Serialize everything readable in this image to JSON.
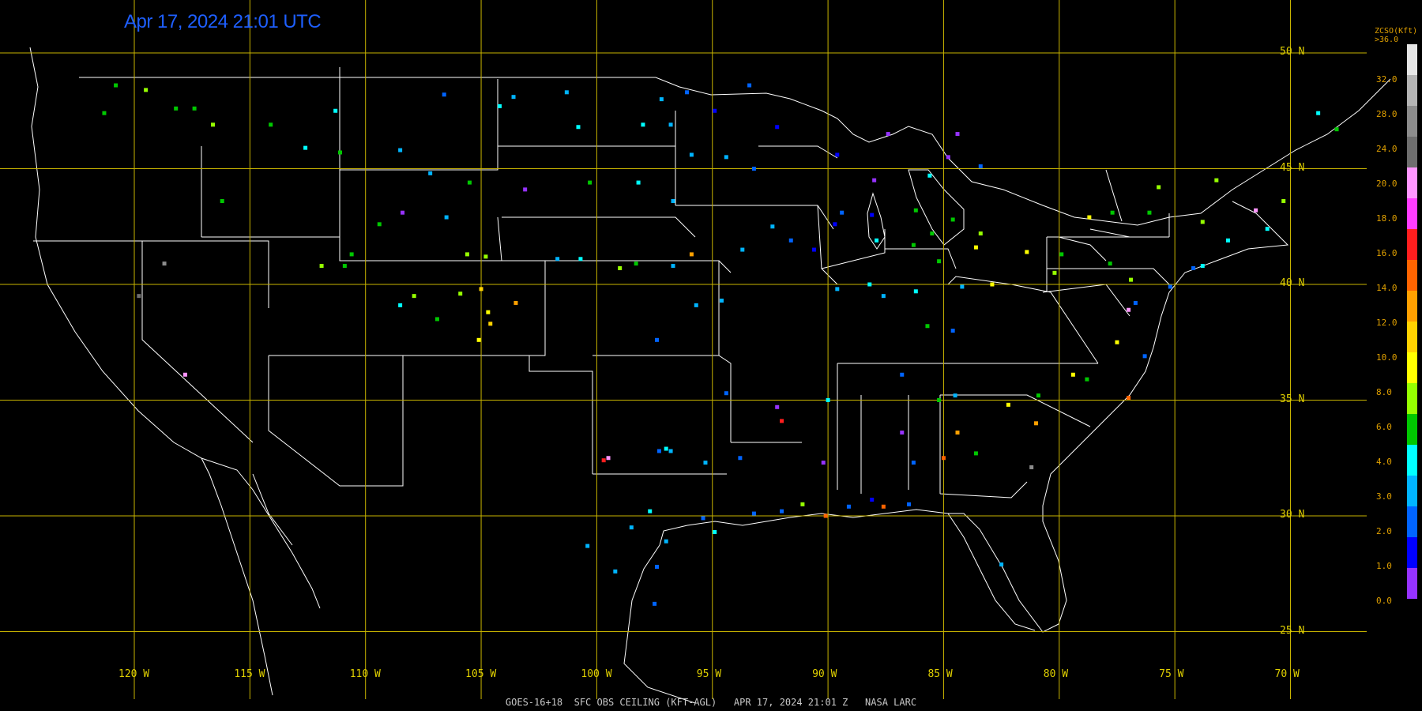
{
  "title": "Apr 17, 2024 21:01 UTC",
  "footer": "GOES-16+18  SFC OBS CEILING (KFT-AGL)   APR 17, 2024 21:01 Z   NASA LARC",
  "legend": {
    "title_line1": "ZCSO(Kft)",
    "title_line2": ">36.0",
    "labels": [
      "32.0",
      "28.0",
      "24.0",
      "20.0",
      "18.0",
      "16.0",
      "14.0",
      "12.0",
      "10.0",
      "8.0",
      "6.0",
      "4.0",
      "3.0",
      "2.0",
      "1.0",
      "0.0"
    ],
    "colors": [
      "#e6e6e6",
      "#b4b4b4",
      "#8c8c8c",
      "#6e6e6e",
      "#ff96ff",
      "#ff3cff",
      "#ff1e1e",
      "#ff6400",
      "#ffa000",
      "#ffd200",
      "#ffff00",
      "#96ff00",
      "#00c800",
      "#00ffff",
      "#00b4ff",
      "#0064ff",
      "#0000ff",
      "#9632ff"
    ]
  },
  "lat_labels": [
    "50 N",
    "45 N",
    "40 N",
    "35 N",
    "30 N",
    "25 N"
  ],
  "lon_labels": [
    "120 W",
    "115 W",
    "110 W",
    "105 W",
    "100 W",
    "95 W",
    "90 W",
    "85 W",
    "80 W",
    "75 W",
    "70 W"
  ],
  "stations": [
    {
      "lon": -120.8,
      "lat": 48.6,
      "c": "#00c800"
    },
    {
      "lon": -119.5,
      "lat": 48.4,
      "c": "#96ff00"
    },
    {
      "lon": -121.3,
      "lat": 47.4,
      "c": "#00c800"
    },
    {
      "lon": -118.2,
      "lat": 47.6,
      "c": "#00c800"
    },
    {
      "lon": -117.4,
      "lat": 47.6,
      "c": "#00c800"
    },
    {
      "lon": -116.6,
      "lat": 46.9,
      "c": "#96ff00"
    },
    {
      "lon": -116.2,
      "lat": 43.6,
      "c": "#00c800"
    },
    {
      "lon": -114.1,
      "lat": 46.9,
      "c": "#00c800"
    },
    {
      "lon": -112.6,
      "lat": 45.9,
      "c": "#00ffff"
    },
    {
      "lon": -111.1,
      "lat": 45.7,
      "c": "#00c800"
    },
    {
      "lon": -111.3,
      "lat": 47.5,
      "c": "#00ffff"
    },
    {
      "lon": -108.5,
      "lat": 45.8,
      "c": "#00b4ff"
    },
    {
      "lon": -106.6,
      "lat": 48.2,
      "c": "#0064ff"
    },
    {
      "lon": -104.2,
      "lat": 47.7,
      "c": "#00ffff"
    },
    {
      "lon": -103.6,
      "lat": 48.1,
      "c": "#00b4ff"
    },
    {
      "lon": -101.3,
      "lat": 48.3,
      "c": "#00b4ff"
    },
    {
      "lon": -100.8,
      "lat": 46.8,
      "c": "#00ffff"
    },
    {
      "lon": -98.0,
      "lat": 46.9,
      "c": "#00ffff"
    },
    {
      "lon": -96.8,
      "lat": 46.9,
      "c": "#00b4ff"
    },
    {
      "lon": -97.2,
      "lat": 48.0,
      "c": "#00b4ff"
    },
    {
      "lon": -96.1,
      "lat": 48.3,
      "c": "#0064ff"
    },
    {
      "lon": -94.9,
      "lat": 47.5,
      "c": "#0000ff"
    },
    {
      "lon": -93.4,
      "lat": 48.6,
      "c": "#0064ff"
    },
    {
      "lon": -92.2,
      "lat": 46.8,
      "c": "#0000ff"
    },
    {
      "lon": -93.2,
      "lat": 45.0,
      "c": "#0064ff"
    },
    {
      "lon": -94.4,
      "lat": 45.5,
      "c": "#00b4ff"
    },
    {
      "lon": -95.9,
      "lat": 45.6,
      "c": "#00b4ff"
    },
    {
      "lon": -96.7,
      "lat": 43.6,
      "c": "#00b4ff"
    },
    {
      "lon": -98.2,
      "lat": 44.4,
      "c": "#00ffff"
    },
    {
      "lon": -100.3,
      "lat": 44.4,
      "c": "#00c800"
    },
    {
      "lon": -103.1,
      "lat": 44.1,
      "c": "#9632ff"
    },
    {
      "lon": -104.8,
      "lat": 41.2,
      "c": "#96ff00"
    },
    {
      "lon": -105.6,
      "lat": 41.3,
      "c": "#96ff00"
    },
    {
      "lon": -106.5,
      "lat": 42.9,
      "c": "#00b4ff"
    },
    {
      "lon": -108.4,
      "lat": 43.1,
      "c": "#9632ff"
    },
    {
      "lon": -109.4,
      "lat": 42.6,
      "c": "#00c800"
    },
    {
      "lon": -107.2,
      "lat": 44.8,
      "c": "#00b4ff"
    },
    {
      "lon": -105.5,
      "lat": 44.4,
      "c": "#00c800"
    },
    {
      "lon": -105.0,
      "lat": 39.8,
      "c": "#ffd200"
    },
    {
      "lon": -104.7,
      "lat": 38.8,
      "c": "#ffff00"
    },
    {
      "lon": -104.6,
      "lat": 38.3,
      "c": "#ffd200"
    },
    {
      "lon": -103.5,
      "lat": 39.2,
      "c": "#ffa000"
    },
    {
      "lon": -105.9,
      "lat": 39.6,
      "c": "#96ff00"
    },
    {
      "lon": -107.9,
      "lat": 39.5,
      "c": "#96ff00"
    },
    {
      "lon": -108.5,
      "lat": 39.1,
      "c": "#00ffff"
    },
    {
      "lon": -106.9,
      "lat": 38.5,
      "c": "#00c800"
    },
    {
      "lon": -105.1,
      "lat": 37.6,
      "c": "#ffff00"
    },
    {
      "lon": -110.9,
      "lat": 40.8,
      "c": "#00c800"
    },
    {
      "lon": -111.9,
      "lat": 40.8,
      "c": "#96ff00"
    },
    {
      "lon": -110.6,
      "lat": 41.3,
      "c": "#00c800"
    },
    {
      "lon": -119.8,
      "lat": 39.5,
      "c": "#6e6e6e"
    },
    {
      "lon": -117.8,
      "lat": 36.1,
      "c": "#ff96ff"
    },
    {
      "lon": -118.7,
      "lat": 40.9,
      "c": "#8c8c8c"
    },
    {
      "lon": -101.7,
      "lat": 41.1,
      "c": "#00b4ff"
    },
    {
      "lon": -100.7,
      "lat": 41.1,
      "c": "#00ffff"
    },
    {
      "lon": -99.0,
      "lat": 40.7,
      "c": "#96ff00"
    },
    {
      "lon": -98.3,
      "lat": 40.9,
      "c": "#00c800"
    },
    {
      "lon": -96.7,
      "lat": 40.8,
      "c": "#00b4ff"
    },
    {
      "lon": -95.9,
      "lat": 41.3,
      "c": "#ffa000"
    },
    {
      "lon": -95.7,
      "lat": 39.1,
      "c": "#00b4ff"
    },
    {
      "lon": -97.4,
      "lat": 37.6,
      "c": "#0064ff"
    },
    {
      "lon": -94.6,
      "lat": 39.3,
      "c": "#00b4ff"
    },
    {
      "lon": -93.7,
      "lat": 41.5,
      "c": "#00b4ff"
    },
    {
      "lon": -92.4,
      "lat": 42.5,
      "c": "#00b4ff"
    },
    {
      "lon": -91.6,
      "lat": 41.9,
      "c": "#0064ff"
    },
    {
      "lon": -90.6,
      "lat": 41.5,
      "c": "#0000ff"
    },
    {
      "lon": -89.7,
      "lat": 42.6,
      "c": "#0000ff"
    },
    {
      "lon": -89.4,
      "lat": 43.1,
      "c": "#0064ff"
    },
    {
      "lon": -88.1,
      "lat": 43.0,
      "c": "#0000ff"
    },
    {
      "lon": -87.9,
      "lat": 41.9,
      "c": "#00ffff"
    },
    {
      "lon": -88.2,
      "lat": 40.0,
      "c": "#00ffff"
    },
    {
      "lon": -89.6,
      "lat": 39.8,
      "c": "#00b4ff"
    },
    {
      "lon": -87.6,
      "lat": 39.5,
      "c": "#00b4ff"
    },
    {
      "lon": -86.2,
      "lat": 39.7,
      "c": "#00ffff"
    },
    {
      "lon": -85.2,
      "lat": 41.0,
      "c": "#00c800"
    },
    {
      "lon": -86.3,
      "lat": 41.7,
      "c": "#00c800"
    },
    {
      "lon": -85.5,
      "lat": 42.2,
      "c": "#00c800"
    },
    {
      "lon": -84.6,
      "lat": 42.8,
      "c": "#00c800"
    },
    {
      "lon": -83.4,
      "lat": 42.2,
      "c": "#96ff00"
    },
    {
      "lon": -83.6,
      "lat": 41.6,
      "c": "#ffff00"
    },
    {
      "lon": -84.2,
      "lat": 39.9,
      "c": "#00b4ff"
    },
    {
      "lon": -82.9,
      "lat": 40.0,
      "c": "#ffff00"
    },
    {
      "lon": -81.4,
      "lat": 41.4,
      "c": "#ffff00"
    },
    {
      "lon": -80.2,
      "lat": 40.5,
      "c": "#96ff00"
    },
    {
      "lon": -79.9,
      "lat": 41.3,
      "c": "#00c800"
    },
    {
      "lon": -77.8,
      "lat": 40.9,
      "c": "#00c800"
    },
    {
      "lon": -76.9,
      "lat": 40.2,
      "c": "#96ff00"
    },
    {
      "lon": -75.2,
      "lat": 39.9,
      "c": "#0064ff"
    },
    {
      "lon": -74.2,
      "lat": 40.7,
      "c": "#0064ff"
    },
    {
      "lon": -73.8,
      "lat": 40.8,
      "c": "#00ffff"
    },
    {
      "lon": -72.7,
      "lat": 41.9,
      "c": "#00ffff"
    },
    {
      "lon": -71.0,
      "lat": 42.4,
      "c": "#00ffff"
    },
    {
      "lon": -70.3,
      "lat": 43.6,
      "c": "#96ff00"
    },
    {
      "lon": -71.5,
      "lat": 43.2,
      "c": "#ff96ff"
    },
    {
      "lon": -73.2,
      "lat": 44.5,
      "c": "#96ff00"
    },
    {
      "lon": -75.7,
      "lat": 44.2,
      "c": "#96ff00"
    },
    {
      "lon": -76.1,
      "lat": 43.1,
      "c": "#00c800"
    },
    {
      "lon": -77.7,
      "lat": 43.1,
      "c": "#00c800"
    },
    {
      "lon": -78.7,
      "lat": 42.9,
      "c": "#ffff00"
    },
    {
      "lon": -73.8,
      "lat": 42.7,
      "c": "#96ff00"
    },
    {
      "lon": -68.0,
      "lat": 46.7,
      "c": "#00c800"
    },
    {
      "lon": -68.8,
      "lat": 47.4,
      "c": "#00ffff"
    },
    {
      "lon": -77.0,
      "lat": 38.9,
      "c": "#ff96ff"
    },
    {
      "lon": -76.7,
      "lat": 39.2,
      "c": "#0064ff"
    },
    {
      "lon": -77.5,
      "lat": 37.5,
      "c": "#ffff00"
    },
    {
      "lon": -76.3,
      "lat": 36.9,
      "c": "#0064ff"
    },
    {
      "lon": -78.8,
      "lat": 35.9,
      "c": "#00c800"
    },
    {
      "lon": -80.9,
      "lat": 35.2,
      "c": "#00c800"
    },
    {
      "lon": -77.0,
      "lat": 35.1,
      "c": "#ff6400"
    },
    {
      "lon": -79.4,
      "lat": 36.1,
      "c": "#ffff00"
    },
    {
      "lon": -81.0,
      "lat": 34.0,
      "c": "#ffa000"
    },
    {
      "lon": -82.2,
      "lat": 34.8,
      "c": "#ffff00"
    },
    {
      "lon": -84.4,
      "lat": 33.6,
      "c": "#ffa000"
    },
    {
      "lon": -83.6,
      "lat": 32.7,
      "c": "#00c800"
    },
    {
      "lon": -85.0,
      "lat": 32.5,
      "c": "#ff6400"
    },
    {
      "lon": -81.2,
      "lat": 32.1,
      "c": "#8c8c8c"
    },
    {
      "lon": -84.5,
      "lat": 35.2,
      "c": "#00b4ff"
    },
    {
      "lon": -86.8,
      "lat": 36.1,
      "c": "#0064ff"
    },
    {
      "lon": -85.7,
      "lat": 38.2,
      "c": "#00c800"
    },
    {
      "lon": -84.6,
      "lat": 38.0,
      "c": "#0064ff"
    },
    {
      "lon": -85.2,
      "lat": 35.0,
      "c": "#00c800"
    },
    {
      "lon": -86.8,
      "lat": 33.6,
      "c": "#9632ff"
    },
    {
      "lon": -86.3,
      "lat": 32.3,
      "c": "#0064ff"
    },
    {
      "lon": -88.1,
      "lat": 30.7,
      "c": "#0000ff"
    },
    {
      "lon": -89.1,
      "lat": 30.4,
      "c": "#0064ff"
    },
    {
      "lon": -90.1,
      "lat": 30.0,
      "c": "#ff6400"
    },
    {
      "lon": -90.2,
      "lat": 32.3,
      "c": "#9632ff"
    },
    {
      "lon": -91.1,
      "lat": 30.5,
      "c": "#96ff00"
    },
    {
      "lon": -92.0,
      "lat": 30.2,
      "c": "#0064ff"
    },
    {
      "lon": -93.2,
      "lat": 30.1,
      "c": "#0064ff"
    },
    {
      "lon": -90.0,
      "lat": 35.0,
      "c": "#00ffff"
    },
    {
      "lon": -92.2,
      "lat": 34.7,
      "c": "#9632ff"
    },
    {
      "lon": -92.0,
      "lat": 34.1,
      "c": "#ff1e1e"
    },
    {
      "lon": -94.4,
      "lat": 35.3,
      "c": "#0064ff"
    },
    {
      "lon": -93.8,
      "lat": 32.5,
      "c": "#0064ff"
    },
    {
      "lon": -95.4,
      "lat": 29.9,
      "c": "#0064ff"
    },
    {
      "lon": -94.9,
      "lat": 29.3,
      "c": "#00ffff"
    },
    {
      "lon": -97.0,
      "lat": 28.9,
      "c": "#00b4ff"
    },
    {
      "lon": -97.4,
      "lat": 27.8,
      "c": "#0064ff"
    },
    {
      "lon": -97.5,
      "lat": 26.2,
      "c": "#0064ff"
    },
    {
      "lon": -98.5,
      "lat": 29.5,
      "c": "#00b4ff"
    },
    {
      "lon": -97.7,
      "lat": 30.2,
      "c": "#00ffff"
    },
    {
      "lon": -97.0,
      "lat": 32.9,
      "c": "#00ffff"
    },
    {
      "lon": -96.8,
      "lat": 32.8,
      "c": "#00b4ff"
    },
    {
      "lon": -97.3,
      "lat": 32.8,
      "c": "#0064ff"
    },
    {
      "lon": -99.7,
      "lat": 32.4,
      "c": "#ff1e1e"
    },
    {
      "lon": -99.5,
      "lat": 32.5,
      "c": "#ff96ff"
    },
    {
      "lon": -95.3,
      "lat": 32.3,
      "c": "#00b4ff"
    },
    {
      "lon": -100.4,
      "lat": 28.7,
      "c": "#00b4ff"
    },
    {
      "lon": -99.2,
      "lat": 27.6,
      "c": "#00b4ff"
    },
    {
      "lon": -87.6,
      "lat": 30.4,
      "c": "#ff6400"
    },
    {
      "lon": -86.5,
      "lat": 30.5,
      "c": "#0064ff"
    },
    {
      "lon": -82.5,
      "lat": 27.9,
      "c": "#00b4ff"
    },
    {
      "lon": -88.0,
      "lat": 44.5,
      "c": "#9632ff"
    },
    {
      "lon": -89.6,
      "lat": 45.6,
      "c": "#0000ff"
    },
    {
      "lon": -87.4,
      "lat": 46.5,
      "c": "#9632ff"
    },
    {
      "lon": -84.4,
      "lat": 46.5,
      "c": "#9632ff"
    },
    {
      "lon": -85.6,
      "lat": 44.7,
      "c": "#00ffff"
    },
    {
      "lon": -84.8,
      "lat": 45.5,
      "c": "#9632ff"
    },
    {
      "lon": -83.4,
      "lat": 45.1,
      "c": "#0064ff"
    },
    {
      "lon": -86.2,
      "lat": 43.2,
      "c": "#00c800"
    }
  ]
}
